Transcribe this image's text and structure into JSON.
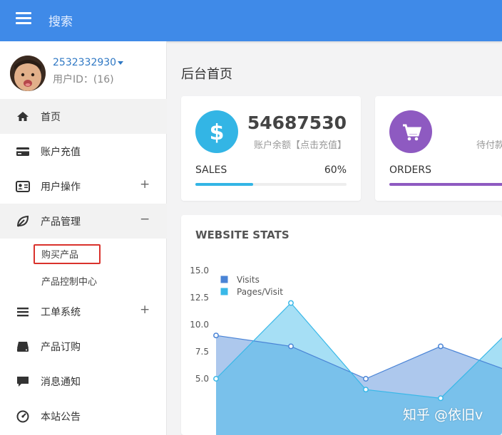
{
  "header": {
    "search_label": "搜索"
  },
  "user": {
    "name": "2532332930",
    "id_text": "用户ID：(16)"
  },
  "sidebar": {
    "items": [
      {
        "label": "首页",
        "icon": "home-icon",
        "toggle": ""
      },
      {
        "label": "账户充值",
        "icon": "credit-card-icon",
        "toggle": ""
      },
      {
        "label": "用户操作",
        "icon": "user-card-icon",
        "toggle": "+"
      },
      {
        "label": "产品管理",
        "icon": "leaf-icon",
        "toggle": "−"
      },
      {
        "label": "工单系统",
        "icon": "list-icon",
        "toggle": "+"
      },
      {
        "label": "产品订购",
        "icon": "drive-icon",
        "toggle": ""
      },
      {
        "label": "消息通知",
        "icon": "chat-icon",
        "toggle": ""
      },
      {
        "label": "本站公告",
        "icon": "dashboard-icon",
        "toggle": ""
      }
    ],
    "subitems": [
      {
        "label": "购买产品"
      },
      {
        "label": "产品控制中心"
      }
    ]
  },
  "main": {
    "title": "后台首页",
    "card1": {
      "amount": "54687530",
      "caption": "账户余额【点击充值】",
      "label": "SALES",
      "percent": "60%",
      "progress": 0.6,
      "color": "#33b5e5",
      "icon": "dollar-icon"
    },
    "card2": {
      "caption": "待付款",
      "label": "ORDERS",
      "color": "#8e5ac1",
      "icon": "cart-icon"
    },
    "stats_title": "WEBSITE STATS"
  },
  "chart_data": {
    "type": "area",
    "x": [
      1,
      2,
      3,
      4,
      5,
      6
    ],
    "yticks": [
      "15.0",
      "12.5",
      "10.0",
      "7.5",
      "5.0"
    ],
    "ylim": [
      2.5,
      15.0
    ],
    "series": [
      {
        "name": "Visits",
        "color": "#4a84d6",
        "values": [
          9,
          8,
          5,
          8,
          5.5,
          null
        ]
      },
      {
        "name": "Pages/Visit",
        "color": "#39b8e8",
        "values": [
          5,
          12,
          4,
          3.2,
          10,
          null
        ]
      }
    ],
    "legend": "top-left"
  },
  "watermark": "知乎 @依旧v"
}
